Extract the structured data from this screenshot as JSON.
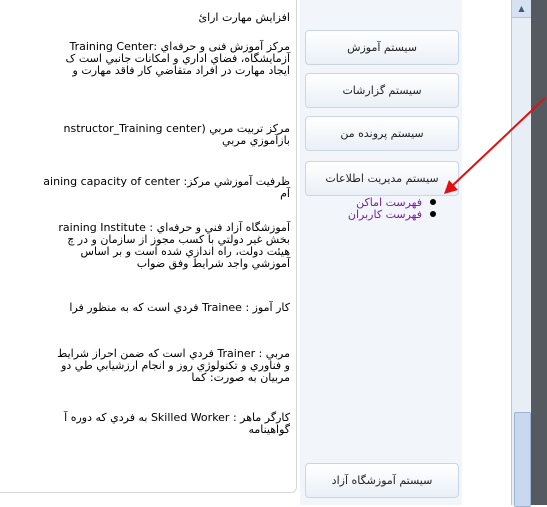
{
  "content": {
    "paragraphs": [
      {
        "lines": [
          "افزایش مهارت ارائ"
        ]
      },
      {
        "lines": [
          "مرکز آموزش فنی و حرفه‌اي :Training Center",
          "آزمایشگاه، فضاي اداري و امکانات جانبي است ک",
          "ایجاد مهارت در افراد متقاضي کار فاقد مهارت و"
        ]
      },
      {
        "lines": [
          "مرکز تربیت مربي (nstructor_Training center",
          "بازآموزي مربي"
        ]
      },
      {
        "lines": [
          "ظرفیت آموزشي مرکز: aining capacity of center",
          "آم"
        ]
      },
      {
        "lines": [
          "آموزشگاه آزاد فني و حرفه‌اي : raining Institute",
          "بخش غیر دولتي با کسب مجوز از سازمان و در چ",
          "هیئت دولت، راه اندازي شده است و بر اساس",
          "آموزشي واجد شرایط وفق ضواب"
        ]
      },
      {
        "lines": [
          "کار آموز : Trainee فردي است که به منظور فرا"
        ]
      },
      {
        "lines": [
          "مربي : Trainer فردي است که ضمن احراز شرایط",
          "و فناوري و تکنولوژي روز و انجام ارزشیابي طي دو",
          "مربیان به صورت: کما"
        ]
      },
      {
        "lines": [
          "کارگر ماهر : Skilled Worker به فردي که دوره آ",
          "گواهینامه"
        ]
      }
    ]
  },
  "menu": {
    "training_system": "سیستم آموزش",
    "reports_system": "سیستم گزارشات",
    "my_files_system": "سیستم پرونده من",
    "info_management": "سیستم مدیریت اطلاعات",
    "sub_items": [
      "فهرست اماکن",
      "فهرست کاربران"
    ],
    "free_institute_system": "سیستم آموزشگاه آزاد"
  },
  "colors": {
    "link_purple": "#7b1fa2",
    "annotation_arrow": "#e01010"
  },
  "icons": {
    "scroll_up": "▲"
  }
}
